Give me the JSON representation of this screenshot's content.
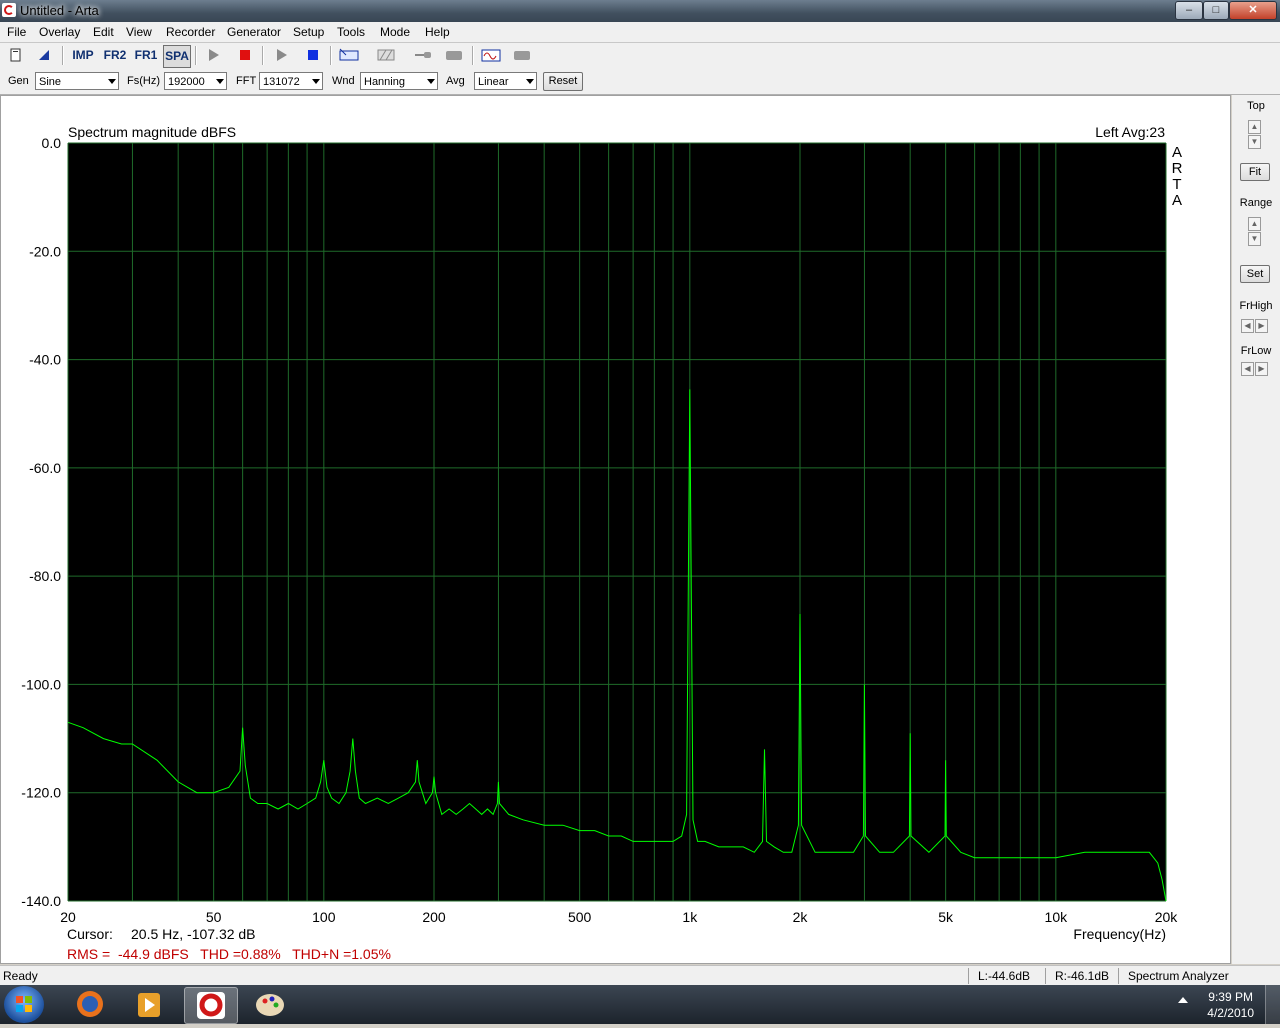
{
  "window": {
    "title": "Untitled - Arta"
  },
  "menu": [
    "File",
    "Overlay",
    "Edit",
    "View",
    "Recorder",
    "Generator",
    "Setup",
    "Tools",
    "Mode",
    "Help"
  ],
  "toolbar": {
    "imp_label": "IMP",
    "fr2_label": "FR2",
    "fr1_label": "FR1",
    "spa_label": "SPA"
  },
  "controls": {
    "gen_label": "Gen",
    "gen_value": "Sine",
    "fs_label": "Fs(Hz)",
    "fs_value": "192000",
    "fft_label": "FFT",
    "fft_value": "131072",
    "wnd_label": "Wnd",
    "wnd_value": "Hanning",
    "avg_label": "Avg",
    "avg_value": "Linear",
    "reset_label": "Reset"
  },
  "right_panel": {
    "top_label": "Top",
    "fit_label": "Fit",
    "range_label": "Range",
    "set_label": "Set",
    "frhigh_label": "FrHigh",
    "frlow_label": "FrLow"
  },
  "plot": {
    "channel_label": "Left  Avg:23",
    "watermark": [
      "A",
      "R",
      "T",
      "A"
    ],
    "cursor_label": "Cursor:",
    "cursor_value": "20.5 Hz, -107.32 dB",
    "stats": "RMS =  -44.9 dBFS   THD =0.88%   THD+N =1.05%"
  },
  "chart_data": {
    "type": "line",
    "title": "Spectrum magnitude dBFS",
    "xlabel": "Frequency(Hz)",
    "ylabel": "",
    "xscale": "log",
    "xlim": [
      20,
      20000
    ],
    "ylim": [
      -140,
      0
    ],
    "x_ticks": [
      {
        "v": 20,
        "label": "20"
      },
      {
        "v": 50,
        "label": "50"
      },
      {
        "v": 100,
        "label": "100"
      },
      {
        "v": 200,
        "label": "200"
      },
      {
        "v": 500,
        "label": "500"
      },
      {
        "v": 1000,
        "label": "1k"
      },
      {
        "v": 2000,
        "label": "2k"
      },
      {
        "v": 5000,
        "label": "5k"
      },
      {
        "v": 10000,
        "label": "10k"
      },
      {
        "v": 20000,
        "label": "20k"
      }
    ],
    "y_ticks": [
      {
        "v": 0,
        "label": "0.0"
      },
      {
        "v": -20,
        "label": "-20.0"
      },
      {
        "v": -40,
        "label": "-40.0"
      },
      {
        "v": -60,
        "label": "-60.0"
      },
      {
        "v": -80,
        "label": "-80.0"
      },
      {
        "v": -100,
        "label": "-100.0"
      },
      {
        "v": -120,
        "label": "-120.0"
      },
      {
        "v": -140,
        "label": "-140.0"
      }
    ],
    "grid": true,
    "background": "#000000",
    "grid_color": "#1f6b2a",
    "line_color": "#00ff00",
    "series": [
      {
        "x": [
          20,
          22,
          25,
          28,
          30,
          35,
          40,
          45,
          50,
          55,
          59,
          60,
          61,
          63,
          66,
          70,
          75,
          80,
          85,
          90,
          95,
          98,
          100,
          102,
          105,
          110,
          115,
          118,
          120,
          122,
          125,
          130,
          140,
          150,
          160,
          170,
          178,
          180,
          182,
          190,
          198,
          200,
          202,
          210,
          220,
          230,
          240,
          250,
          260,
          270,
          280,
          290,
          298,
          300,
          302,
          320,
          350,
          400,
          450,
          500,
          550,
          600,
          650,
          700,
          750,
          800,
          850,
          900,
          950,
          980,
          1000,
          1020,
          1050,
          1100,
          1200,
          1300,
          1400,
          1500,
          1580,
          1600,
          1620,
          1700,
          1800,
          1900,
          1980,
          2000,
          2020,
          2200,
          2500,
          2800,
          2980,
          3000,
          3020,
          3300,
          3600,
          3980,
          4000,
          4020,
          4500,
          4980,
          5000,
          5020,
          5500,
          6000,
          7000,
          8000,
          9000,
          10000,
          12000,
          14000,
          16000,
          17000,
          18000,
          18500,
          19000,
          19500,
          20000
        ],
        "y": [
          -107,
          -108,
          -110,
          -111,
          -111,
          -114,
          -118,
          -120,
          -120,
          -119,
          -116,
          -108,
          -115,
          -121,
          -122,
          -122,
          -123,
          -122,
          -123,
          -122,
          -121,
          -118,
          -114,
          -119,
          -121,
          -122,
          -120,
          -116,
          -110,
          -116,
          -121,
          -122,
          -121,
          -122,
          -121,
          -120,
          -118,
          -114,
          -118,
          -122,
          -120,
          -117,
          -120,
          -124,
          -123,
          -124,
          -123,
          -122,
          -123,
          -124,
          -123,
          -124,
          -122,
          -118,
          -122,
          -124,
          -125,
          -126,
          -126,
          -127,
          -127,
          -128,
          -128,
          -129,
          -129,
          -129,
          -129,
          -129,
          -128,
          -124,
          -45.5,
          -125,
          -129,
          -129,
          -130,
          -130,
          -130,
          -131,
          -129,
          -112,
          -129,
          -130,
          -131,
          -131,
          -126,
          -87,
          -126,
          -131,
          -131,
          -131,
          -128,
          -100,
          -128,
          -131,
          -131,
          -128,
          -109,
          -128,
          -131,
          -128,
          -114,
          -128,
          -131,
          -132,
          -132,
          -132,
          -132,
          -132,
          -131,
          -131,
          -131,
          -131,
          -131,
          -132,
          -133,
          -136,
          -140
        ]
      }
    ]
  },
  "status": {
    "ready": "Ready",
    "left_level": "L:-44.6dB",
    "right_level": "R:-46.1dB",
    "mode": "Spectrum Analyzer"
  },
  "taskbar": {
    "time": "9:39 PM",
    "date": "4/2/2010"
  }
}
